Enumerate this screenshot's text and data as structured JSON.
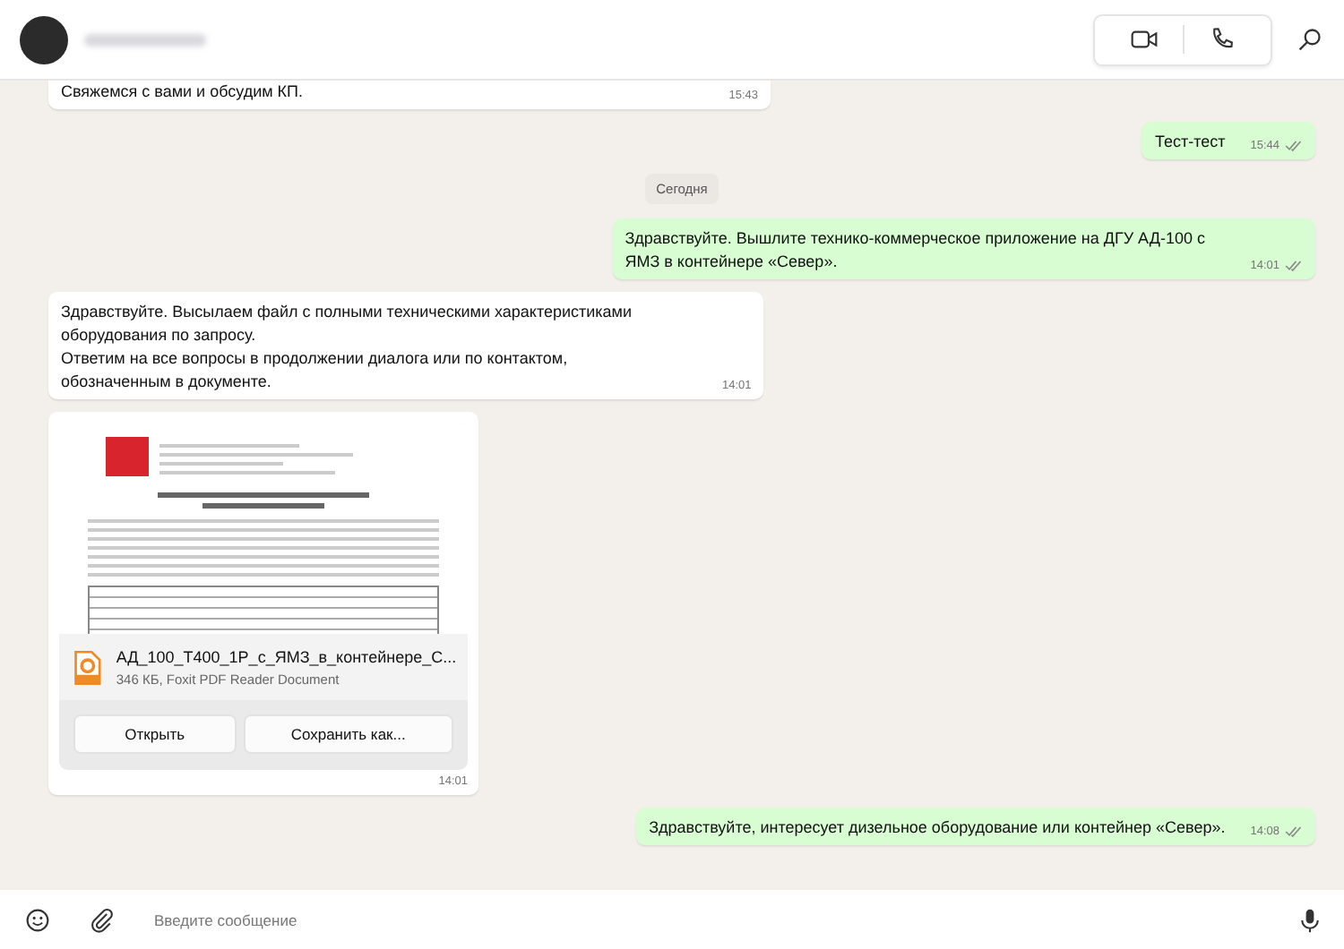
{
  "messages": [
    {
      "kind": "text",
      "outgoing": false,
      "text": "Свяжемся с вами и обсудим КП.",
      "time": "15:43",
      "delivered": false
    },
    {
      "kind": "text",
      "outgoing": true,
      "text": "Тест-тест",
      "time": "15:44",
      "delivered": true
    },
    {
      "kind": "date",
      "text": "Сегодня"
    },
    {
      "kind": "text",
      "outgoing": true,
      "text": "Здравствуйте. Вышлите технико-коммерческое приложение на ДГУ АД-100 с ЯМЗ в контейнере «Север».",
      "time": "14:01",
      "delivered": true
    },
    {
      "kind": "text",
      "outgoing": false,
      "text": "Здравствуйте. Высылаем файл с полными техническими характеристиками оборудования по запросу.\nОтветим на все вопросы в продолжении диалога или по контактом,\nобозначенным в документе.",
      "time": "14:01",
      "delivered": false
    },
    {
      "kind": "file",
      "outgoing": false,
      "file_name": "АД_100_Т400_1Р_с_ЯМЗ_в_контейнере_С...",
      "file_info": "346 КБ, Foxit PDF Reader Document",
      "buttons": [
        "Открыть",
        "Сохранить как..."
      ],
      "time": "14:01",
      "delivered": false
    },
    {
      "kind": "text",
      "outgoing": true,
      "text": "Здравствуйте, интересует дизельное оборудование или контейнер «Север».",
      "time": "14:08",
      "delivered": true
    }
  ],
  "composer": {
    "placeholder": "Введите сообщение"
  }
}
